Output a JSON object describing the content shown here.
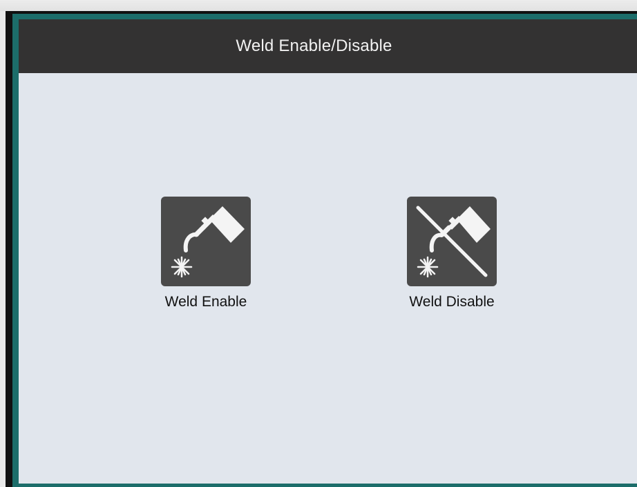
{
  "window": {
    "title": "Weld Enable/Disable"
  },
  "actions": [
    {
      "label": "Weld Enable",
      "icon": "weld-torch-icon"
    },
    {
      "label": "Weld Disable",
      "icon": "weld-torch-disabled-icon"
    }
  ],
  "colors": {
    "header_background": "#333232",
    "screen_background": "#e1e6ed",
    "icon_tile": "#4a4a4a",
    "frame_accent": "#1c6d6a"
  }
}
